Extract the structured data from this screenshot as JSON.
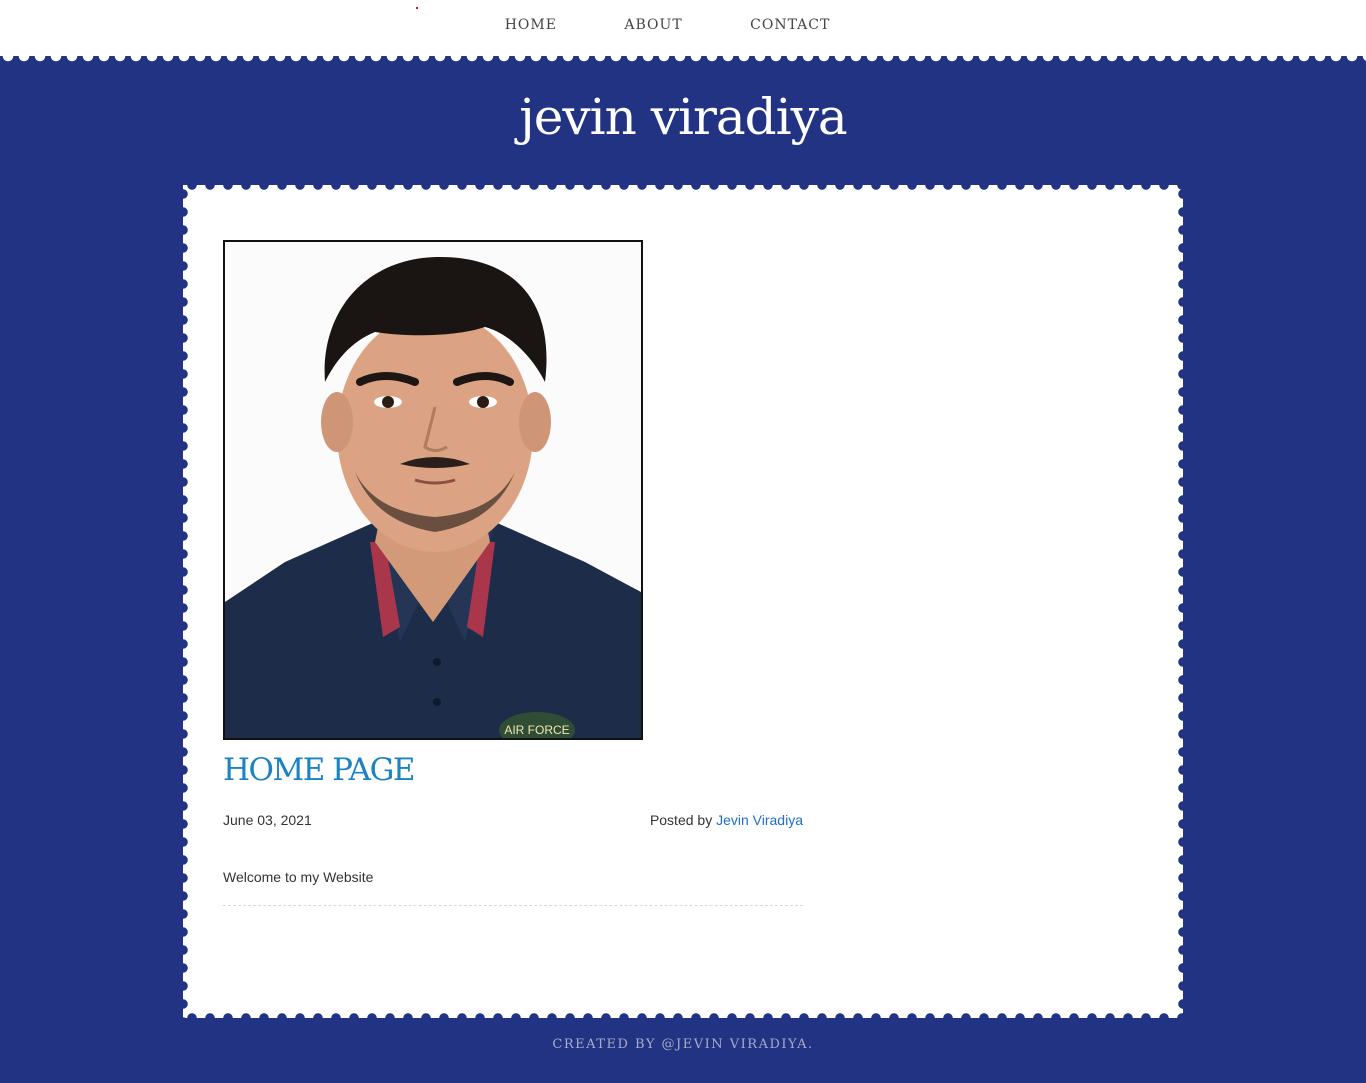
{
  "nav": {
    "items": [
      {
        "label": "HOME"
      },
      {
        "label": "ABOUT"
      },
      {
        "label": "CONTACT"
      }
    ]
  },
  "site": {
    "title": "jevin viradiya"
  },
  "colors": {
    "background": "#233384",
    "accent": "#1b82c6",
    "link": "#1b6fc7"
  },
  "post": {
    "photo_alt": "profile-photo",
    "shirt_patch_text": "AIR FORCE",
    "title": "HOME PAGE",
    "date": "June 03, 2021",
    "posted_by_label": "Posted by",
    "author": "Jevin Viradiya",
    "body": "Welcome to my Website"
  },
  "footer": {
    "text": "CREATED BY @JEVIN VIRADIYA."
  }
}
